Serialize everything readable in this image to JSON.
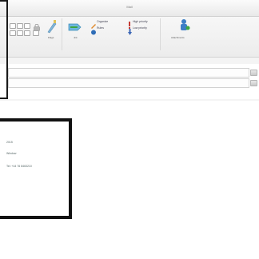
{
  "window": {
    "title": "Mail"
  },
  "ribbon": {
    "groups": [
      {
        "name": "clipboard",
        "caption": ""
      },
      {
        "name": "flags",
        "caption": "Flags"
      },
      {
        "name": "junk",
        "caption": "Jnk"
      },
      {
        "name": "rules",
        "caption": ""
      },
      {
        "name": "attachments",
        "caption": "Attachments"
      }
    ],
    "side_items": {
      "item1": "Organize",
      "item2": "Rules",
      "item3": "High priority",
      "item4": "Low priority"
    },
    "account_label": "Account folder"
  },
  "fields": [
    {
      "name": "to",
      "value": ""
    },
    {
      "name": "cc",
      "value": ""
    }
  ],
  "preview": {
    "lines": [
      "2015",
      "Window",
      "Tel: +44 76 8463210"
    ]
  },
  "colors": {
    "accent_blue": "#2f6db7",
    "accent_green": "#3ca541",
    "accent_red": "#c63b33",
    "frame_black": "#111111"
  }
}
